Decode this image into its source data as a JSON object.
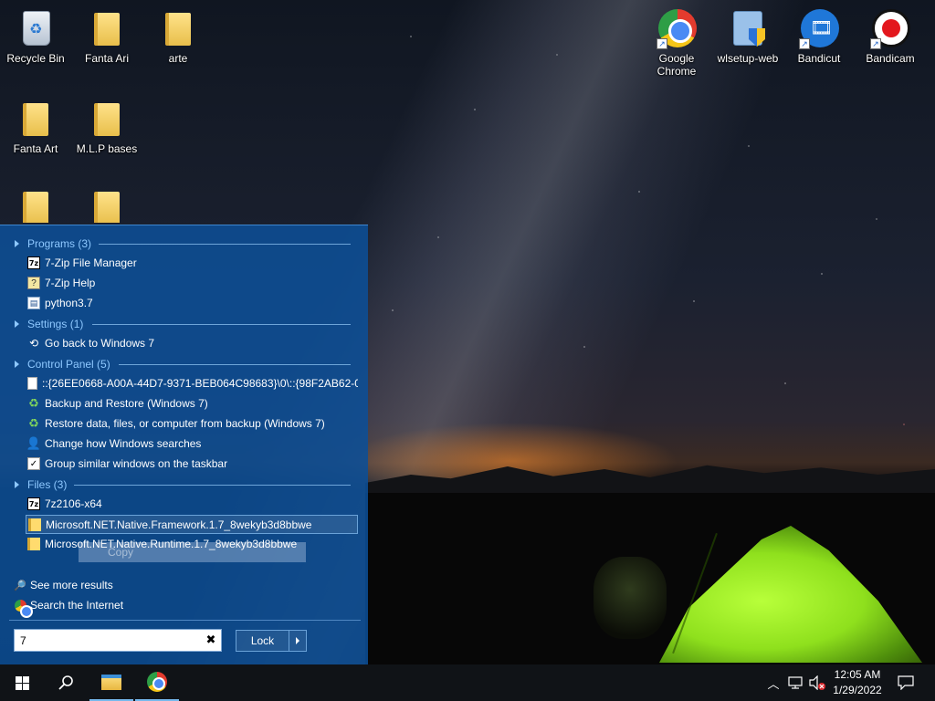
{
  "desktop": {
    "icons": [
      {
        "label": "Recycle Bin",
        "icon": "recycle-bin-icon"
      },
      {
        "label": "Fanta Ari",
        "icon": "folder-icon"
      },
      {
        "label": "arte",
        "icon": "folder-icon"
      },
      {
        "label": "Fanta Art",
        "icon": "folder-icon"
      },
      {
        "label": "M.L.P bases",
        "icon": "folder-icon"
      },
      {
        "label": "Google Chrome",
        "icon": "chrome-icon"
      },
      {
        "label": "wlsetup-web",
        "icon": "wlsetup-icon"
      },
      {
        "label": "Bandicut",
        "icon": "bandicut-icon"
      },
      {
        "label": "Bandicam",
        "icon": "bandicam-icon"
      }
    ]
  },
  "start_menu": {
    "sections": [
      {
        "title": "Programs (3)",
        "items": [
          "7-Zip File Manager",
          "7-Zip Help",
          "python3.7"
        ]
      },
      {
        "title": "Settings (1)",
        "items": [
          "Go back to Windows 7"
        ]
      },
      {
        "title": "Control Panel (5)",
        "items": [
          "::{26EE0668-A00A-44D7-9371-BEB064C98683}\\0\\::{98F2AB62-0E...",
          "Backup and Restore (Windows 7)",
          "Restore data, files, or computer from backup (Windows 7)",
          "Change how Windows searches",
          "Group similar windows on the taskbar"
        ]
      },
      {
        "title": "Files (3)",
        "items": [
          "7z2106-x64",
          "Microsoft.NET.Native.Framework.1.7_8wekyb3d8bbwe",
          "Microsoft.NET.Native.Runtime.1.7_8wekyb3d8bbwe"
        ]
      }
    ],
    "tooltip": "Copy",
    "see_more": "See more results",
    "search_internet": "Search the Internet",
    "search_value": "7",
    "lock_label": "Lock"
  },
  "taskbar": {
    "time": "12:05 AM",
    "date": "1/29/2022"
  },
  "colors": {
    "menu_bg": "#0c4e96",
    "section_header": "#8ec8ff",
    "taskbar": "#101317"
  }
}
